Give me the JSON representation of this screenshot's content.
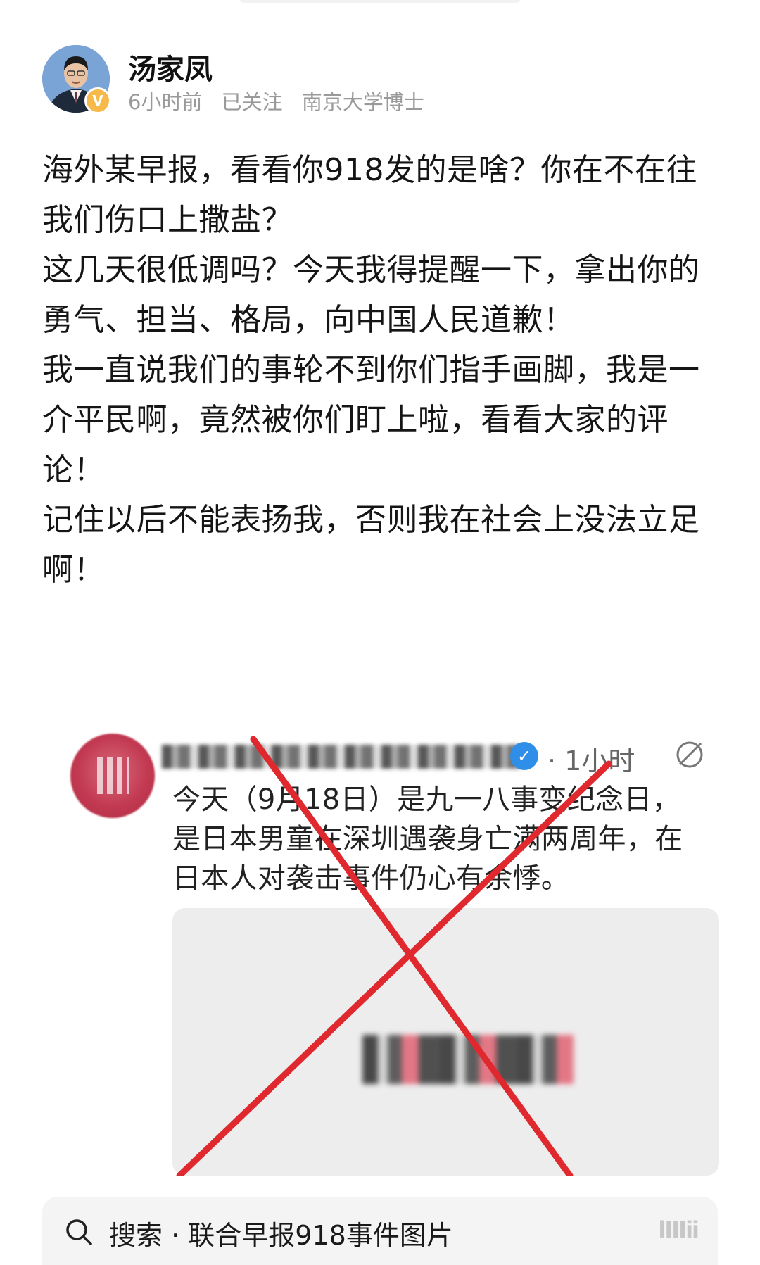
{
  "author": {
    "name": "汤家凤",
    "verified_badge": "V",
    "time": "6小时前",
    "follow_status": "已关注",
    "title": "南京大学博士"
  },
  "post": {
    "paragraphs": [
      "海外某早报，看看你918发的是啥？你在不在往我们伤口上撒盐？",
      "这几天很低调吗？今天我得提醒一下，拿出你的勇气、担当、格局，向中国人民道歉！",
      "我一直说我们的事轮不到你们指手画脚，我是一介平民啊，竟然被你们盯上啦，看看大家的评论！",
      "记住以后不能表扬我，否则我在社会上没法立足啊！"
    ]
  },
  "embedded_post": {
    "time": "· 1小时",
    "text_lines": [
      "今天（9月18日）是九一八事变纪念日，",
      "是日本男童在深圳遇袭身亡满两周年，在",
      "日本人对袭击事件仍心有余悸。"
    ],
    "cross_color": "#e0282f",
    "check_color": "#2f8fe8"
  },
  "search": {
    "label": "搜索",
    "separator": "·",
    "query": "联合早报918事件图片",
    "watermark": "lIIIii"
  },
  "colors": {
    "meta": "#9a9a9a",
    "badge": "#f6b94a",
    "search_bg": "#f4f4f4"
  }
}
